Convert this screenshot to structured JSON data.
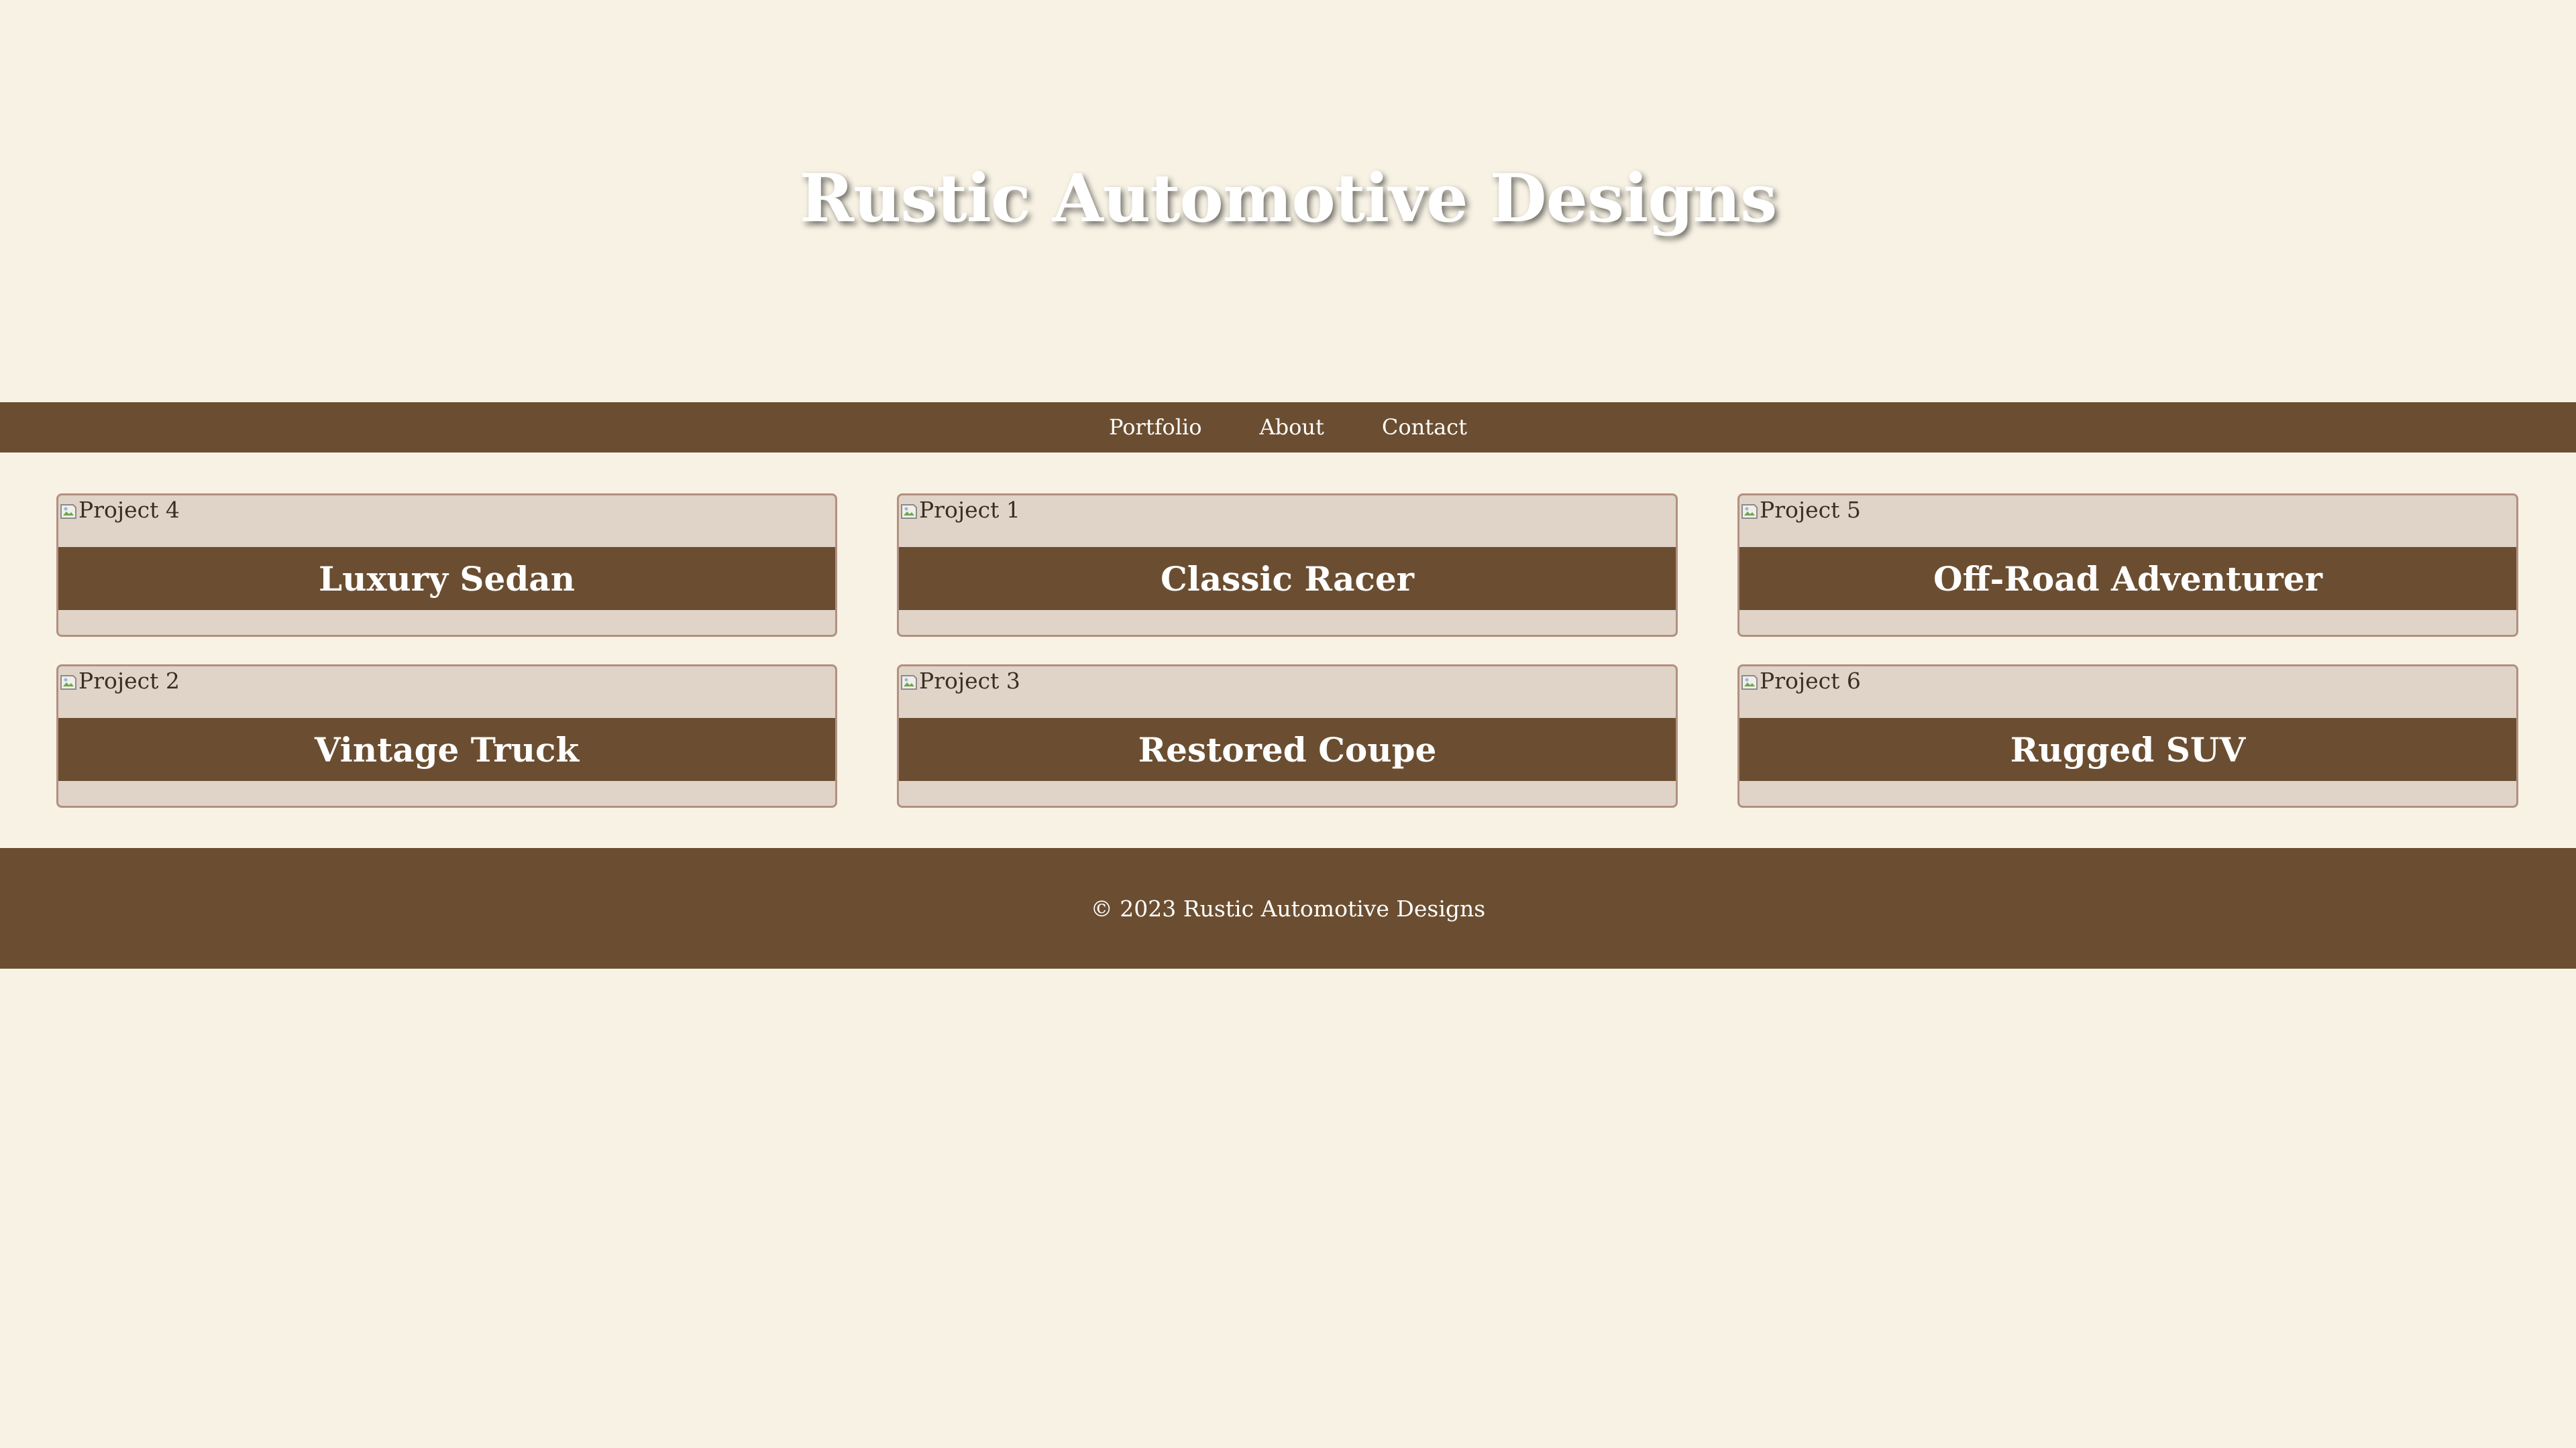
{
  "site": {
    "title": "Rustic Automotive Designs"
  },
  "nav": {
    "items": [
      {
        "label": "Portfolio"
      },
      {
        "label": "About"
      },
      {
        "label": "Contact"
      }
    ]
  },
  "gallery": {
    "cards": [
      {
        "image_alt": "Project 4",
        "title": "Luxury Sedan"
      },
      {
        "image_alt": "Project 1",
        "title": "Classic Racer"
      },
      {
        "image_alt": "Project 5",
        "title": "Off-Road Adventurer"
      },
      {
        "image_alt": "Project 2",
        "title": "Vintage Truck"
      },
      {
        "image_alt": "Project 3",
        "title": "Restored Coupe"
      },
      {
        "image_alt": "Project 6",
        "title": "Rugged SUV"
      }
    ]
  },
  "footer": {
    "copyright": "© 2023 Rustic Automotive Designs"
  },
  "colors": {
    "background": "#f7f2e4",
    "brand_brown": "#6b4e31",
    "card_background": "#e0d3c8",
    "card_border": "#b39080",
    "text_light": "#ffffff"
  },
  "icons": {
    "broken_image": "broken-image-icon"
  }
}
